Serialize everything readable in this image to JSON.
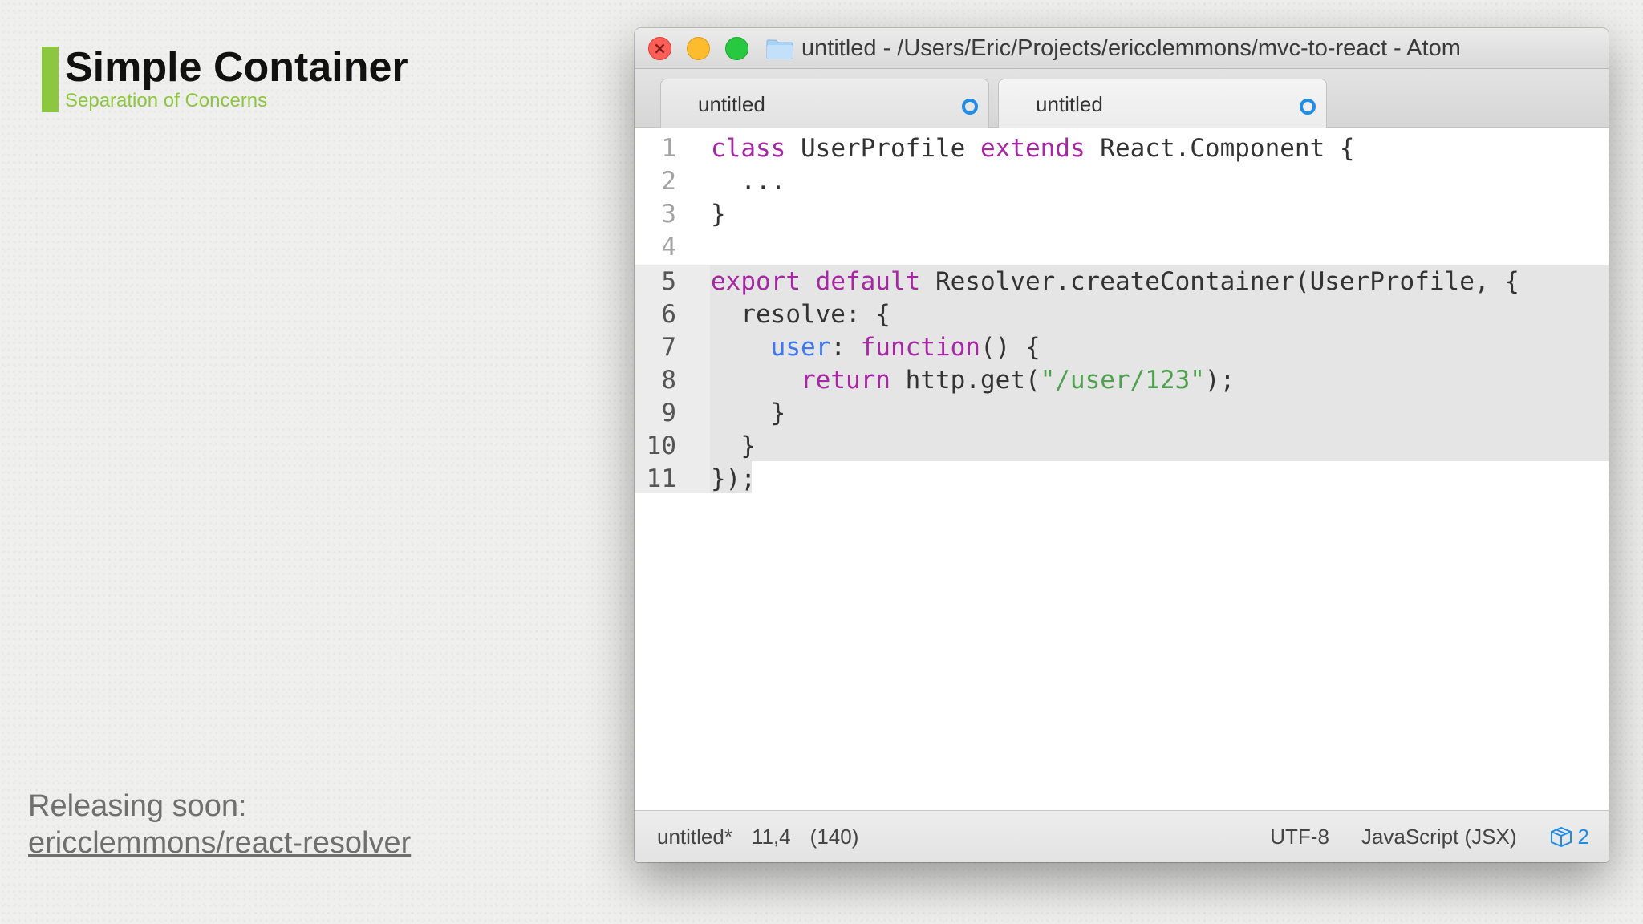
{
  "slide": {
    "title": "Simple Container",
    "subtitle": "Separation of Concerns",
    "release_text": "Releasing soon:",
    "release_link": "ericclemmons/react-resolver",
    "accent_color": "#8dc63f"
  },
  "window": {
    "title": "untitled - /Users/Eric/Projects/ericclemmons/mvc-to-react - Atom",
    "traffic_lights": [
      "close",
      "minimize",
      "maximize"
    ],
    "close_glyph": "×"
  },
  "tabs": [
    {
      "label": "untitled",
      "modified": true,
      "active": false
    },
    {
      "label": "untitled",
      "modified": true,
      "active": true
    }
  ],
  "editor": {
    "lines": [
      {
        "n": "1",
        "code": "class UserProfile extends React.Component {"
      },
      {
        "n": "2",
        "code": "  ..."
      },
      {
        "n": "3",
        "code": "}"
      },
      {
        "n": "4",
        "code": ""
      },
      {
        "n": "5",
        "code": "export default Resolver.createContainer(UserProfile, {"
      },
      {
        "n": "6",
        "code": "  resolve: {"
      },
      {
        "n": "7",
        "code": "    user: function() {"
      },
      {
        "n": "8",
        "code": "      return http.get(\"/user/123\");"
      },
      {
        "n": "9",
        "code": "    }"
      },
      {
        "n": "10",
        "code": "  }"
      },
      {
        "n": "11",
        "code": "});"
      }
    ]
  },
  "statusbar": {
    "file": "untitled*",
    "cursor": "11,4",
    "selection": "(140)",
    "encoding": "UTF-8",
    "grammar": "JavaScript (JSX)",
    "packages_count": "2",
    "package_icon": "package-icon"
  },
  "colors": {
    "keyword": "#a626a4",
    "property": "#4078f2",
    "string": "#50a14f",
    "tab_dot": "#1f8ce9"
  }
}
